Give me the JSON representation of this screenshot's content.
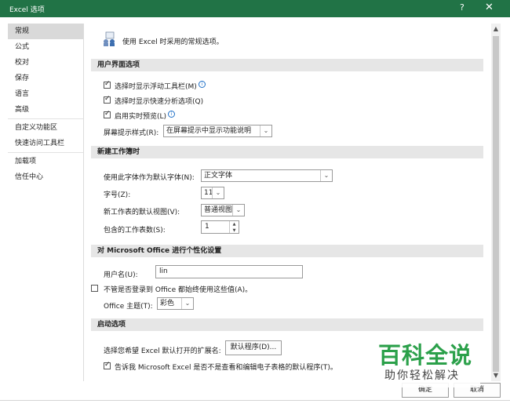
{
  "window": {
    "title": "Excel 选项",
    "help": "?",
    "close": "✕"
  },
  "sidebar": {
    "items": [
      {
        "label": "常规"
      },
      {
        "label": "公式"
      },
      {
        "label": "校对"
      },
      {
        "label": "保存"
      },
      {
        "label": "语言"
      },
      {
        "label": "高级"
      },
      {
        "label": "自定义功能区"
      },
      {
        "label": "快速访问工具栏"
      },
      {
        "label": "加载项"
      },
      {
        "label": "信任中心"
      }
    ],
    "active_index": 0
  },
  "intro": {
    "text": "使用 Excel 时采用的常规选项。",
    "icon": "general-options-icon"
  },
  "ui_options": {
    "header": "用户界面选项",
    "show_mini_toolbar": {
      "label": "选择时显示浮动工具栏(M)",
      "checked": true
    },
    "show_quick_analysis": {
      "label": "选择时显示快速分析选项(Q)",
      "checked": true
    },
    "live_preview": {
      "label": "启用实时预览(L)",
      "checked": true
    },
    "screentip_style": {
      "label": "屏幕提示样式(R):",
      "value": "在屏幕提示中显示功能说明"
    }
  },
  "new_workbook": {
    "header": "新建工作簿时",
    "font": {
      "label": "使用此字体作为默认字体(N):",
      "value": "正文字体"
    },
    "size": {
      "label": "字号(Z):",
      "value": "11"
    },
    "view": {
      "label": "新工作表的默认视图(V):",
      "value": "普通视图"
    },
    "sheets": {
      "label": "包含的工作表数(S):",
      "value": "1"
    }
  },
  "personalize": {
    "header": "对 Microsoft Office 进行个性化设置",
    "username": {
      "label": "用户名(U):",
      "value": "lin"
    },
    "always_use": {
      "label": "不管是否登录到 Office 都始终使用这些值(A)。",
      "checked": false
    },
    "theme": {
      "label": "Office 主题(T):",
      "value": "彩色"
    }
  },
  "startup": {
    "header": "启动选项",
    "extensions": {
      "label": "选择您希望 Excel 默认打开的扩展名:",
      "button": "默认程序(D)..."
    },
    "tell_me": {
      "label": "告诉我 Microsoft Excel 是否不是查看和编辑电子表格的默认程序(T)。",
      "checked": true
    }
  },
  "footer": {
    "ok": "确定",
    "cancel": "取消"
  },
  "watermark": {
    "title": "百科全说",
    "subtitle": "助你轻松解决"
  },
  "colors": {
    "titlebar": "#217346",
    "watermark": "#2ba04a"
  }
}
